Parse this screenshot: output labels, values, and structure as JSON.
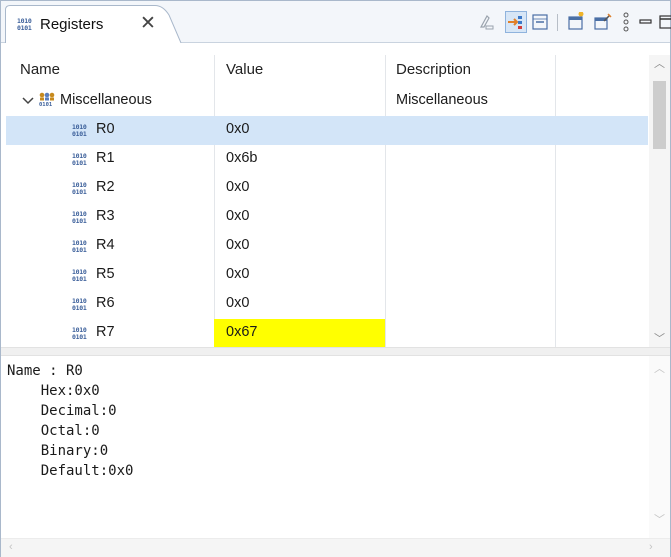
{
  "tab": {
    "title": "Registers",
    "icon": "register-binary-icon"
  },
  "toolbar": {
    "buttons": [
      {
        "name": "show-type-names-button",
        "icon": "type-names-icon"
      },
      {
        "name": "show-registers-button",
        "icon": "layout-icon",
        "active": true
      },
      {
        "name": "collapse-all-button",
        "icon": "collapse-all-icon"
      },
      {
        "name": "add-register-group-button",
        "icon": "add-group-icon"
      },
      {
        "name": "edit-register-group-button",
        "icon": "edit-group-icon"
      },
      {
        "name": "view-menu-button",
        "icon": "vertical-dots-icon"
      }
    ]
  },
  "window_controls": {
    "minimize": "minimize-icon",
    "maximize": "maximize-icon"
  },
  "table": {
    "columns": [
      "Name",
      "Value",
      "Description"
    ],
    "group": {
      "name": "Miscellaneous",
      "description": "Miscellaneous",
      "expanded": true
    },
    "rows": [
      {
        "name": "R0",
        "value": "0x0",
        "selected": true
      },
      {
        "name": "R1",
        "value": "0x6b"
      },
      {
        "name": "R2",
        "value": "0x0"
      },
      {
        "name": "R3",
        "value": "0x0"
      },
      {
        "name": "R4",
        "value": "0x0"
      },
      {
        "name": "R5",
        "value": "0x0"
      },
      {
        "name": "R6",
        "value": "0x0"
      },
      {
        "name": "R7",
        "value": "0x67",
        "changed": true
      }
    ]
  },
  "colors": {
    "selected_row": "#d3e5f8",
    "changed_value": "#ffff00",
    "icon_blue": "#3b5f9a"
  },
  "detail": {
    "lines": [
      "Name : R0",
      "    Hex:0x0",
      "    Decimal:0",
      "    Octal:0",
      "    Binary:0",
      "    Default:0x0"
    ]
  },
  "icon_text": {
    "binary": "1010\n0101"
  }
}
